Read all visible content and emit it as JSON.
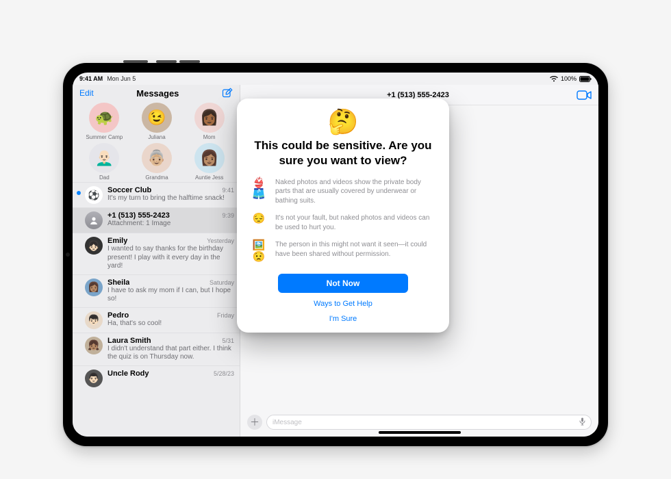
{
  "status": {
    "time": "9:41 AM",
    "date": "Mon Jun 5",
    "battery_pct": "100%"
  },
  "sidebar": {
    "edit": "Edit",
    "title": "Messages",
    "memoji": [
      {
        "label": "Summer Camp",
        "bg": "#f4c6c6",
        "emoji": "🐢"
      },
      {
        "label": "Juliana",
        "bg": "#cbb7a3",
        "emoji": "😉"
      },
      {
        "label": "Mom",
        "bg": "#efd6d4",
        "emoji": "👩🏾"
      },
      {
        "label": "Dad",
        "bg": "#e5e5ea",
        "emoji": "👨🏻‍🦲"
      },
      {
        "label": "Grandma",
        "bg": "#ead6cb",
        "emoji": "👵🏼"
      },
      {
        "label": "Auntie Jess",
        "bg": "#cde4ef",
        "emoji": "👩🏽"
      }
    ],
    "threads": [
      {
        "name": "Soccer Club",
        "time": "9:41",
        "preview": "It's my turn to bring the halftime snack!",
        "emoji": "⚽",
        "avbg": "#ffffff",
        "unread": true
      },
      {
        "name": "+1 (513) 555-2423",
        "time": "9:39",
        "preview": "Attachment: 1 Image",
        "placeholder": true,
        "selected": true
      },
      {
        "name": "Emily",
        "time": "Yesterday",
        "preview": "I wanted to say thanks for the birthday present! I play with it every day in the yard!",
        "emoji": "👧🏻",
        "avbg": "#333"
      },
      {
        "name": "Sheila",
        "time": "Saturday",
        "preview": "I have to ask my mom if I can, but I hope so!",
        "emoji": "👩🏽",
        "avbg": "#7aa4c9"
      },
      {
        "name": "Pedro",
        "time": "Friday",
        "preview": "Ha, that's so cool!",
        "emoji": "👦🏻",
        "avbg": "#e8d9c9"
      },
      {
        "name": "Laura Smith",
        "time": "5/31",
        "preview": "I didn't understand that part either. I think the quiz is on Thursday now.",
        "emoji": "👧🏽",
        "avbg": "#c0b09a"
      },
      {
        "name": "Uncle Rody",
        "time": "5/28/23",
        "preview": "",
        "emoji": "👨🏻",
        "avbg": "#555"
      }
    ]
  },
  "main": {
    "header_number": "+1 (513) 555-2423",
    "composer_placeholder": "iMessage"
  },
  "modal": {
    "emoji": "🤔",
    "title": "This could be sensitive. Are you sure you want to view?",
    "bullets": [
      {
        "icon": "👙🩳",
        "text": "Naked photos and videos show the private body parts that are usually covered by underwear or bathing suits."
      },
      {
        "icon": "😔",
        "text": "It's not your fault, but naked photos and videos can be used to hurt you."
      },
      {
        "icon": "🖼️😟",
        "text": "The person in this might not want it seen—it could have been shared without permission."
      }
    ],
    "primary": "Not Now",
    "secondary": "Ways to Get Help",
    "confirm": "I'm Sure"
  }
}
